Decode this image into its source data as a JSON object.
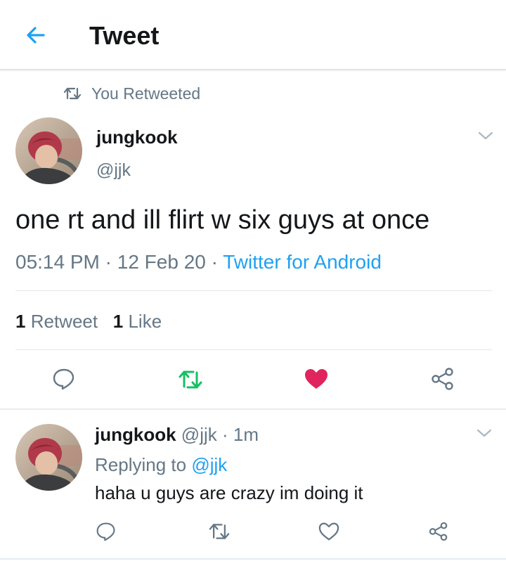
{
  "header": {
    "title": "Tweet",
    "back_icon": "arrow-left-icon",
    "accent": "#1da1f2"
  },
  "retweet_context": {
    "label": "You Retweeted",
    "icon": "retweet-icon"
  },
  "tweet": {
    "author_name": "jungkook",
    "author_handle": "@jjk",
    "text": "one rt and ill flirt w six guys at once",
    "time": "05:14 PM",
    "sep1": " · ",
    "date": "12 Feb 20",
    "sep2": " · ",
    "source": "Twitter for Android",
    "stats": {
      "retweet_count": "1",
      "retweet_label": "Retweet",
      "like_count": "1",
      "like_label": "Like"
    },
    "actions": {
      "reply_icon": "reply-icon",
      "retweet_icon": "retweet-icon",
      "retweet_active_color": "#17bf63",
      "like_icon": "heart-icon",
      "like_active_color": "#e0245e",
      "share_icon": "share-icon"
    }
  },
  "reply": {
    "author_name": "jungkook",
    "author_handle": "@jjk",
    "time_sep": " · ",
    "time": "1m",
    "replying_prefix": "Replying to ",
    "replying_to": "@jjk",
    "text": "haha u guys are crazy im doing it"
  }
}
